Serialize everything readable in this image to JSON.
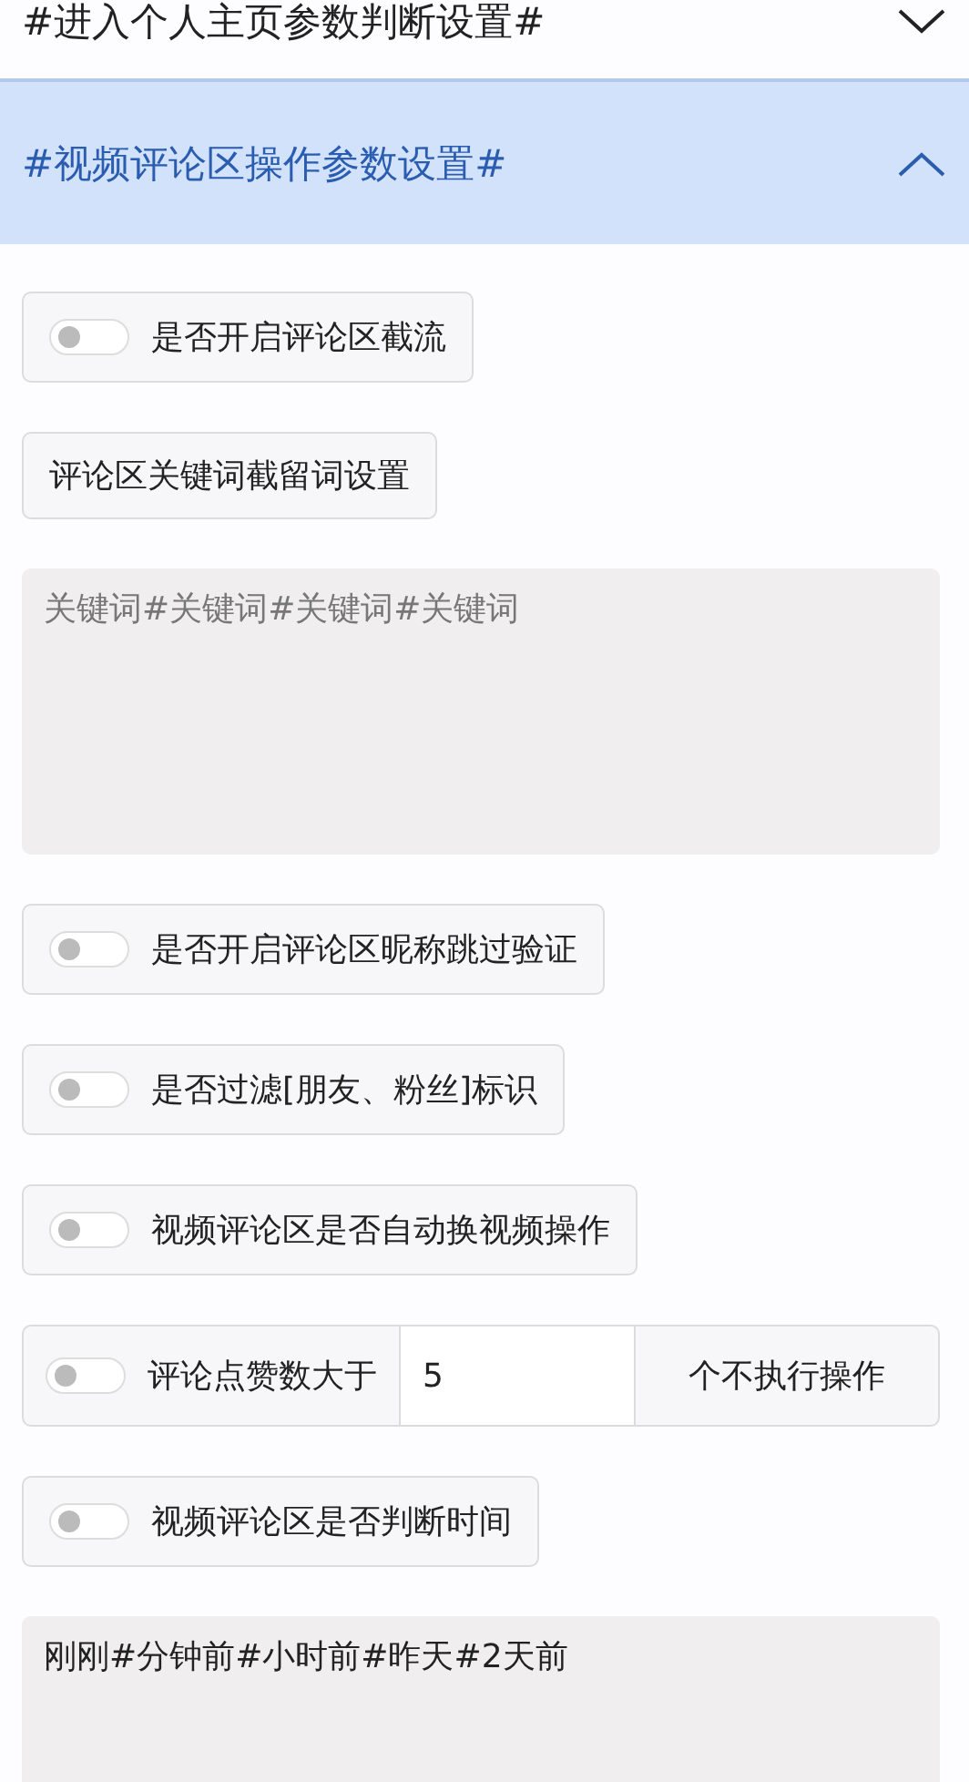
{
  "sections": [
    {
      "title": "#进入个人主页参数判断设置#",
      "expanded": false
    },
    {
      "title": "#视频评论区操作参数设置#",
      "expanded": true,
      "items": [
        {
          "kind": "toggle",
          "label": "是否开启评论区截流",
          "on": false
        },
        {
          "kind": "button",
          "label": "评论区关键词截留词设置"
        },
        {
          "kind": "textarea",
          "placeholder": "关键词#关键词#关键词#关键词"
        },
        {
          "kind": "toggle",
          "label": "是否开启评论区昵称跳过验证",
          "on": false
        },
        {
          "kind": "toggle",
          "label": "是否过滤[朋友、粉丝]标识",
          "on": false
        },
        {
          "kind": "toggle",
          "label": "视频评论区是否自动换视频操作",
          "on": false
        },
        {
          "kind": "toggle_input",
          "label": "评论点赞数大于",
          "on": false,
          "value": "5",
          "suffix": "个不执行操作"
        },
        {
          "kind": "toggle",
          "label": "视频评论区是否判断时间",
          "on": false
        },
        {
          "kind": "textarea",
          "value": "刚刚#分钟前#小时前#昨天#2天前"
        }
      ]
    }
  ]
}
